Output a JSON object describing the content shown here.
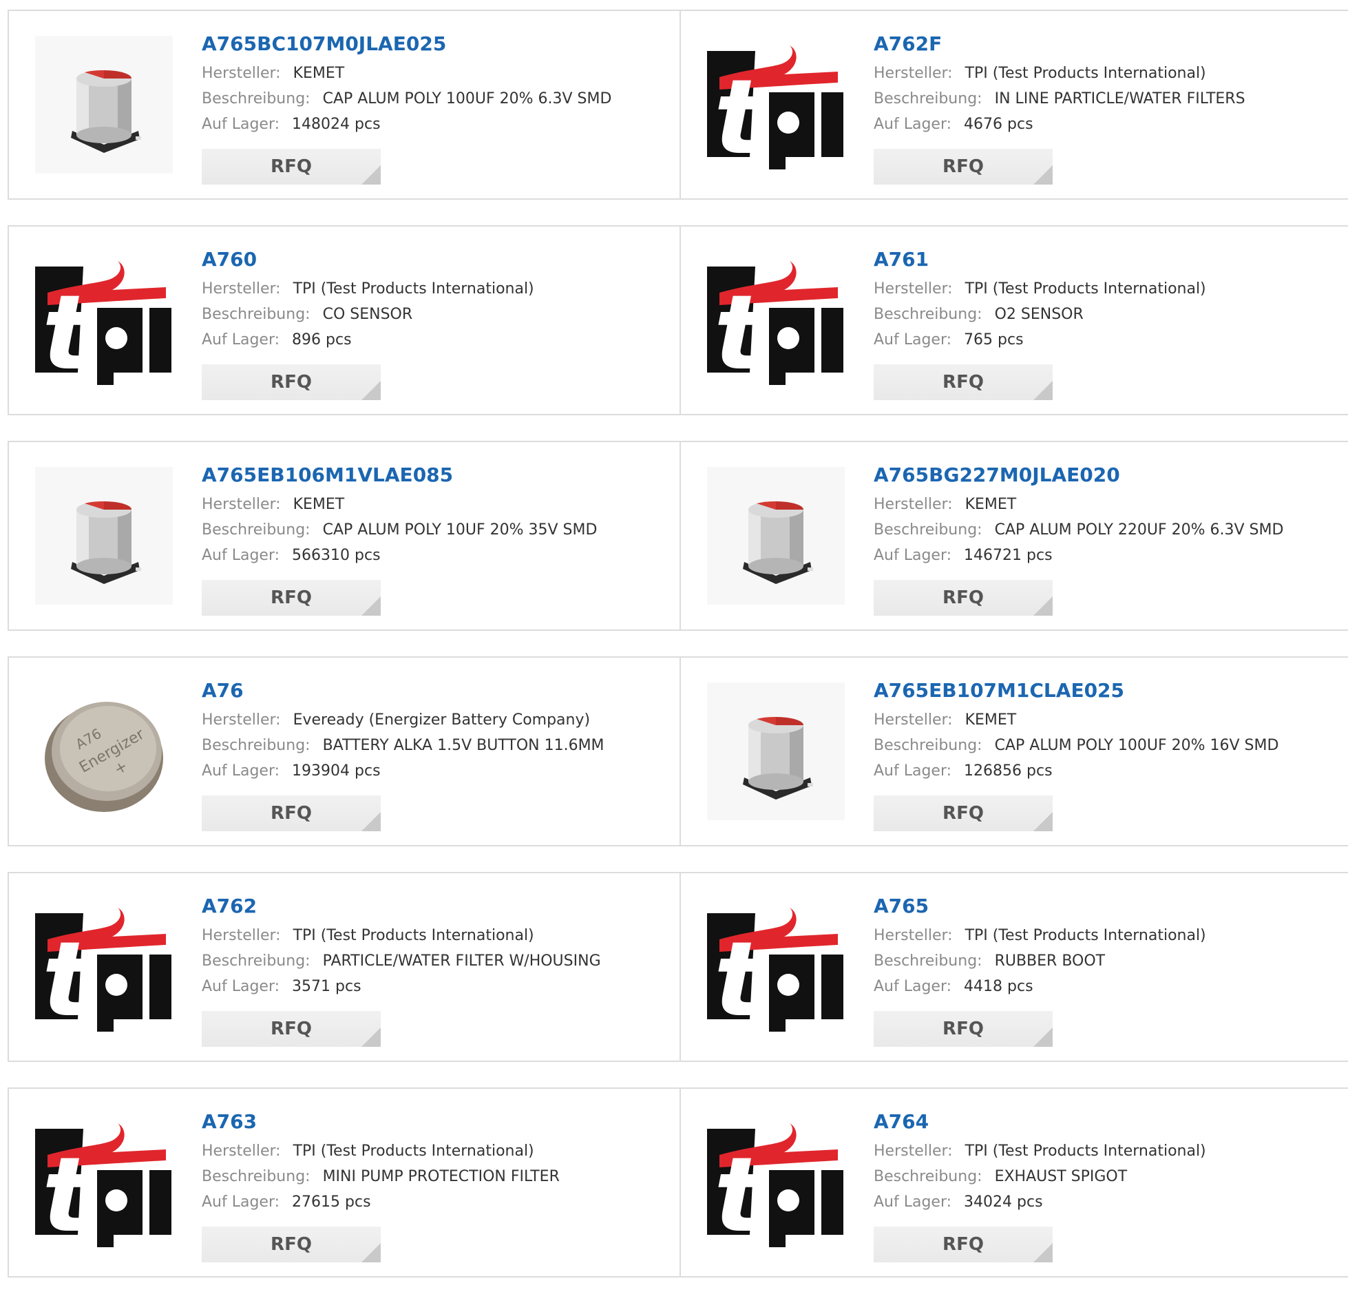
{
  "labels": {
    "manufacturer": "Hersteller:",
    "description": "Beschreibung:",
    "stock": "Auf Lager:",
    "rfq": "RFQ"
  },
  "products": [
    {
      "part": "A765BC107M0JLAE025",
      "manufacturer": "KEMET",
      "description": "CAP ALUM POLY 100UF 20% 6.3V SMD",
      "stock": "148024 pcs",
      "image": "capacitor"
    },
    {
      "part": "A762F",
      "manufacturer": "TPI (Test Products International)",
      "description": "IN LINE PARTICLE/WATER FILTERS",
      "stock": "4676 pcs",
      "image": "tpi-logo"
    },
    {
      "part": "A760",
      "manufacturer": "TPI (Test Products International)",
      "description": "CO SENSOR",
      "stock": "896 pcs",
      "image": "tpi-logo"
    },
    {
      "part": "A761",
      "manufacturer": "TPI (Test Products International)",
      "description": "O2 SENSOR",
      "stock": "765 pcs",
      "image": "tpi-logo"
    },
    {
      "part": "A765EB106M1VLAE085",
      "manufacturer": "KEMET",
      "description": "CAP ALUM POLY 10UF 20% 35V SMD",
      "stock": "566310 pcs",
      "image": "capacitor"
    },
    {
      "part": "A765BG227M0JLAE020",
      "manufacturer": "KEMET",
      "description": "CAP ALUM POLY 220UF 20% 6.3V SMD",
      "stock": "146721 pcs",
      "image": "capacitor"
    },
    {
      "part": "A76",
      "manufacturer": "Eveready (Energizer Battery Company)",
      "description": "BATTERY ALKA 1.5V BUTTON 11.6MM",
      "stock": "193904 pcs",
      "image": "button-battery",
      "battery_text": [
        "A76",
        "Energizer",
        "+"
      ]
    },
    {
      "part": "A765EB107M1CLAE025",
      "manufacturer": "KEMET",
      "description": "CAP ALUM POLY 100UF 20% 16V SMD",
      "stock": "126856 pcs",
      "image": "capacitor"
    },
    {
      "part": "A762",
      "manufacturer": "TPI (Test Products International)",
      "description": "PARTICLE/WATER FILTER W/HOUSING",
      "stock": "3571 pcs",
      "image": "tpi-logo"
    },
    {
      "part": "A765",
      "manufacturer": "TPI (Test Products International)",
      "description": "RUBBER BOOT",
      "stock": "4418 pcs",
      "image": "tpi-logo"
    },
    {
      "part": "A763",
      "manufacturer": "TPI (Test Products International)",
      "description": "MINI PUMP PROTECTION FILTER",
      "stock": "27615 pcs",
      "image": "tpi-logo"
    },
    {
      "part": "A764",
      "manufacturer": "TPI (Test Products International)",
      "description": "EXHAUST SPIGOT",
      "stock": "34024 pcs",
      "image": "tpi-logo"
    }
  ],
  "colors": {
    "part_link": "#1b66b1",
    "label": "#8a8a8a",
    "value": "#333333",
    "border": "#dcdcdc",
    "rfq_bg": "#eeeeee",
    "tpi_red": "#e0262c",
    "tpi_black": "#111111"
  }
}
